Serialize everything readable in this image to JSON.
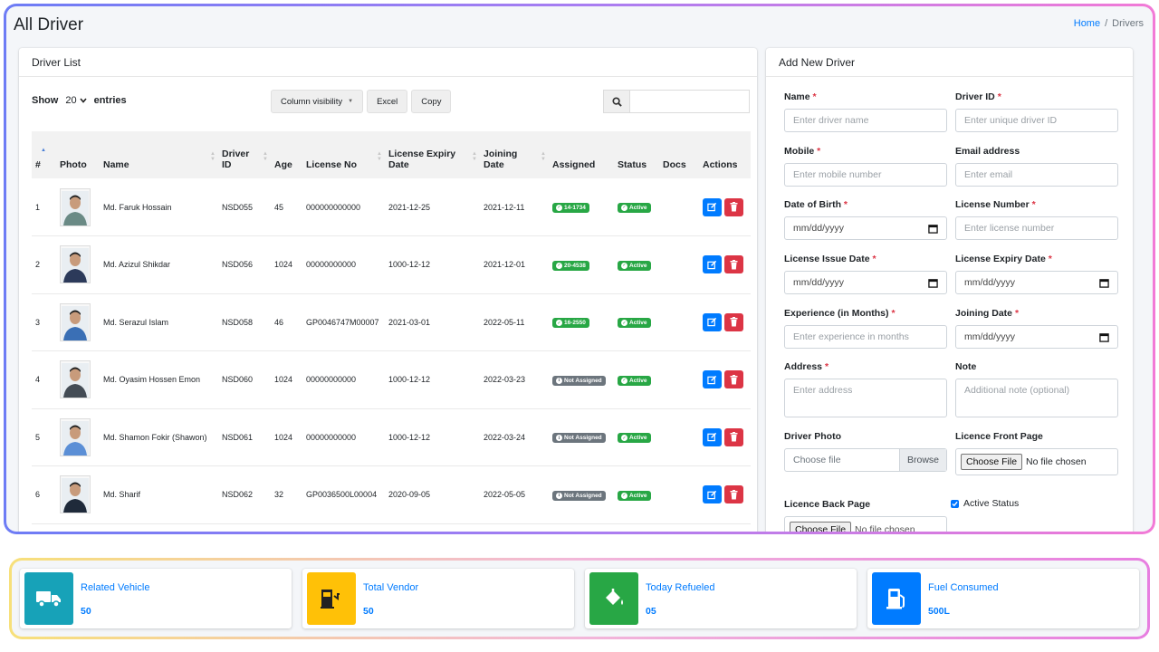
{
  "page": {
    "title": "All Driver"
  },
  "breadcrumb": {
    "home": "Home",
    "sep": "/",
    "current": "Drivers"
  },
  "list": {
    "header": "Driver List",
    "show_label": "Show",
    "entries_value": "20",
    "entries_label": "entries",
    "buttons": {
      "column_visibility": "Column visibility",
      "excel": "Excel",
      "copy": "Copy"
    },
    "search_value": "",
    "columns": [
      "#",
      "Photo",
      "Name",
      "Driver ID",
      "Age",
      "License No",
      "License Expiry Date",
      "Joining Date",
      "Assigned",
      "Status",
      "Docs",
      "Actions"
    ],
    "rows": [
      {
        "n": "1",
        "name": "Md. Faruk Hossain",
        "id": "NSD055",
        "age": "45",
        "license": "000000000000",
        "expiry": "2021-12-25",
        "joining": "2021-12-11",
        "assigned": "14-1734",
        "assigned_state": "assigned",
        "status": "Active",
        "shirt": "#6a8a85"
      },
      {
        "n": "2",
        "name": "Md. Azizul Shikdar",
        "id": "NSD056",
        "age": "1024",
        "license": "00000000000",
        "expiry": "1000-12-12",
        "joining": "2021-12-01",
        "assigned": "20-4538",
        "assigned_state": "assigned",
        "status": "Active",
        "shirt": "#2c3a5a"
      },
      {
        "n": "3",
        "name": "Md. Serazul Islam",
        "id": "NSD058",
        "age": "46",
        "license": "GP0046747M00007",
        "expiry": "2021-03-01",
        "joining": "2022-05-11",
        "assigned": "16-2550",
        "assigned_state": "assigned",
        "status": "Active",
        "shirt": "#3a6fb5"
      },
      {
        "n": "4",
        "name": "Md. Oyasim Hossen Emon",
        "id": "NSD060",
        "age": "1024",
        "license": "00000000000",
        "expiry": "1000-12-12",
        "joining": "2022-03-23",
        "assigned": "Not Assigned",
        "assigned_state": "none",
        "status": "Active",
        "shirt": "#444c55"
      },
      {
        "n": "5",
        "name": "Md. Shamon Fokir (Shawon)",
        "id": "NSD061",
        "age": "1024",
        "license": "00000000000",
        "expiry": "1000-12-12",
        "joining": "2022-03-24",
        "assigned": "Not Assigned",
        "assigned_state": "none",
        "status": "Active",
        "shirt": "#5b8fd6"
      },
      {
        "n": "6",
        "name": "Md. Sharif",
        "id": "NSD062",
        "age": "32",
        "license": "GP0036500L00004",
        "expiry": "2020-09-05",
        "joining": "2022-05-05",
        "assigned": "Not Assigned",
        "assigned_state": "none",
        "status": "Active",
        "shirt": "#1f2a3a"
      }
    ]
  },
  "form": {
    "header": "Add New Driver",
    "name": {
      "label": "Name",
      "placeholder": "Enter driver name"
    },
    "driver_id": {
      "label": "Driver ID",
      "placeholder": "Enter unique driver ID"
    },
    "mobile": {
      "label": "Mobile",
      "placeholder": "Enter mobile number"
    },
    "email": {
      "label": "Email address",
      "placeholder": "Enter email"
    },
    "dob": {
      "label": "Date of Birth",
      "value": "mm/dd/yyyy"
    },
    "license_number": {
      "label": "License Number",
      "placeholder": "Enter license number"
    },
    "issue_date": {
      "label": "License Issue Date",
      "value": "mm/dd/yyyy"
    },
    "expiry_date": {
      "label": "License Expiry Date",
      "value": "mm/dd/yyyy"
    },
    "experience": {
      "label": "Experience (in Months)",
      "placeholder": "Enter experience in months"
    },
    "joining_date": {
      "label": "Joining Date",
      "value": "mm/dd/yyyy"
    },
    "address": {
      "label": "Address",
      "placeholder": "Enter address"
    },
    "note": {
      "label": "Note",
      "placeholder": "Additional note (optional)"
    },
    "photo": {
      "label": "Driver Photo",
      "placeholder": "Choose file",
      "browse": "Browse"
    },
    "front": {
      "label": "Licence Front Page",
      "button": "Choose File",
      "status": "No file chosen"
    },
    "back": {
      "label": "Licence Back Page",
      "button": "Choose File",
      "status": "No file chosen"
    },
    "active": {
      "label": "Active Status",
      "checked": true
    },
    "required_mark": "*"
  },
  "stats": [
    {
      "label": "Related Vehicle",
      "value": "50",
      "color": "#17a2b8",
      "icon": "truck-icon"
    },
    {
      "label": "Total Vendor",
      "value": "50",
      "color": "#ffc107",
      "icon": "fuel-vendor-icon"
    },
    {
      "label": "Today Refueled",
      "value": "05",
      "color": "#28a745",
      "icon": "fill-drip-icon"
    },
    {
      "label": "Fuel Consumed",
      "value": "500L",
      "color": "#007bff",
      "icon": "gas-pump-icon"
    }
  ]
}
